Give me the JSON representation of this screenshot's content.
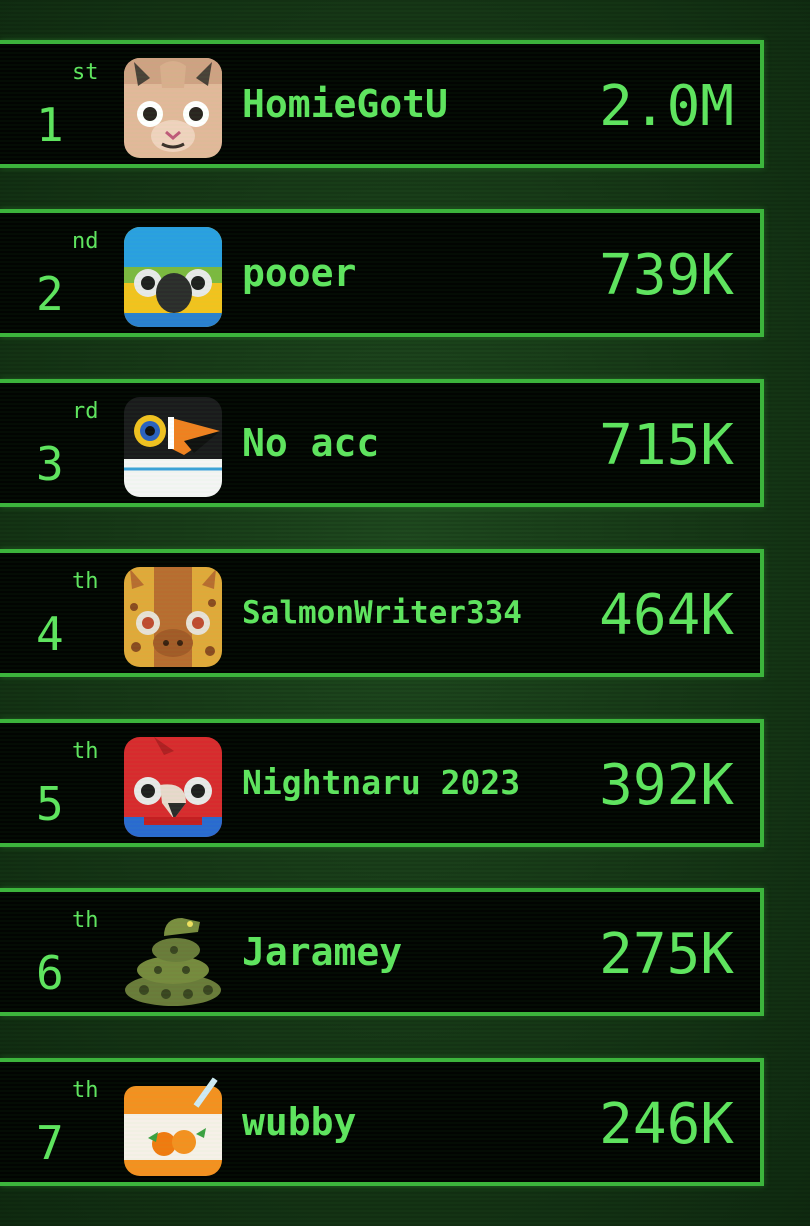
{
  "leaderboard": {
    "entries": [
      {
        "rank": "1",
        "suffix": "st",
        "name": "HomieGotU",
        "score": "2.0M",
        "avatar_icon": "alpaca-avatar-icon"
      },
      {
        "rank": "2",
        "suffix": "nd",
        "name": "pooer",
        "score": "739K",
        "avatar_icon": "blue-macaw-avatar-icon"
      },
      {
        "rank": "3",
        "suffix": "rd",
        "name": "No acc",
        "score": "715K",
        "avatar_icon": "toucan-avatar-icon"
      },
      {
        "rank": "4",
        "suffix": "th",
        "name": "SalmonWriter334",
        "score": "464K",
        "avatar_icon": "giraffe-avatar-icon"
      },
      {
        "rank": "5",
        "suffix": "th",
        "name": "Nightnaru 2023",
        "score": "392K",
        "avatar_icon": "scarlet-macaw-avatar-icon"
      },
      {
        "rank": "6",
        "suffix": "th",
        "name": "Jaramey",
        "score": "275K",
        "avatar_icon": "snake-avatar-icon"
      },
      {
        "rank": "7",
        "suffix": "th",
        "name": "wubby",
        "score": "246K",
        "avatar_icon": "orange-juice-box-avatar-icon"
      }
    ]
  },
  "colors": {
    "text": "#5fe35f",
    "border": "#3cb43c",
    "row_background": "#020402",
    "page_background": "#163816"
  }
}
